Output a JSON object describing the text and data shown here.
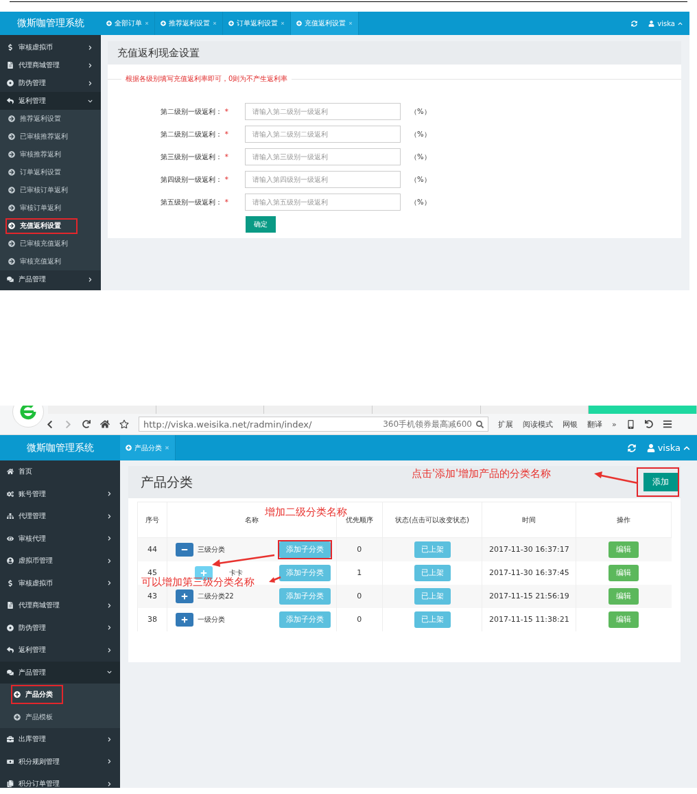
{
  "recharge_screen": {
    "app_title": "微斯咖管理系统",
    "user": "viska",
    "tabs": [
      {
        "label": "全部订单",
        "selected": false
      },
      {
        "label": "推荐返利设置",
        "selected": false
      },
      {
        "label": "订单返利设置",
        "selected": false
      },
      {
        "label": "充值返利设置",
        "selected": true
      }
    ],
    "sidebar": [
      {
        "label": "审核虚拟币",
        "expanded": false
      },
      {
        "label": "代理商城管理",
        "expanded": false
      },
      {
        "label": "防伪管理",
        "expanded": false
      },
      {
        "label": "返利管理",
        "expanded": true,
        "children": [
          {
            "label": "推荐返利设置",
            "selected": false,
            "annotated": false
          },
          {
            "label": "已审核推荐返利",
            "selected": false,
            "annotated": false
          },
          {
            "label": "审核推荐返利",
            "selected": false,
            "annotated": false
          },
          {
            "label": "订单返利设置",
            "selected": false,
            "annotated": false
          },
          {
            "label": "已审核订单返利",
            "selected": false,
            "annotated": false
          },
          {
            "label": "审核订单返利",
            "selected": false,
            "annotated": false
          },
          {
            "label": "充值返利设置",
            "selected": true,
            "annotated": true
          },
          {
            "label": "已审核充值返利",
            "selected": false,
            "annotated": false
          },
          {
            "label": "审核充值返利",
            "selected": false,
            "annotated": false
          }
        ]
      },
      {
        "label": "产品管理",
        "expanded": false
      }
    ],
    "page_title": "充值返利现金设置",
    "notice": "根据各级别填写充值返利率即可，0则为不产生返利率",
    "fields": [
      {
        "label": "第二级别一级返利：",
        "required": "*",
        "placeholder": "请输入第二级别一级返利",
        "unit": "（%）"
      },
      {
        "label": "第二级别二级返利：",
        "required": "*",
        "placeholder": "请输入第二级别二级返利",
        "unit": "（%）"
      },
      {
        "label": "第三级别一级返利：",
        "required": "*",
        "placeholder": "请输入第三级别一级返利",
        "unit": "（%）"
      },
      {
        "label": "第四级别一级返利：",
        "required": "*",
        "placeholder": "请输入第四级别一级返利",
        "unit": "（%）"
      },
      {
        "label": "第五级别一级返利：",
        "required": "*",
        "placeholder": "请输入第五级别一级返利",
        "unit": "（%）"
      }
    ],
    "submit": "确定"
  },
  "product_screen": {
    "browser": {
      "tabs": [
        {
          "selected": false
        },
        {
          "selected": false
        },
        {
          "selected": false
        },
        {
          "selected": false
        },
        {
          "selected": false
        },
        {
          "selected": true
        }
      ],
      "url": "http://viska.weisika.net/radmin/index/",
      "search": "360手机领券最高减600",
      "toolbar_items": [
        "扩展",
        "阅读模式",
        "网银",
        "翻译",
        "»"
      ]
    },
    "app_title": "微斯咖管理系统",
    "tabs": [
      {
        "label": "产品分类",
        "selected": true
      }
    ],
    "user": "viska",
    "sidebar": [
      {
        "label": "首页",
        "has_arrow": false
      },
      {
        "label": "账号管理",
        "has_arrow": true,
        "expanded": false
      },
      {
        "label": "代理管理",
        "has_arrow": true,
        "expanded": false
      },
      {
        "label": "审核代理",
        "has_arrow": true,
        "expanded": false
      },
      {
        "label": "虚拟币管理",
        "has_arrow": true,
        "expanded": false
      },
      {
        "label": "审核虚拟币",
        "has_arrow": true,
        "expanded": false
      },
      {
        "label": "代理商城管理",
        "has_arrow": true,
        "expanded": false
      },
      {
        "label": "防伪管理",
        "has_arrow": true,
        "expanded": false
      },
      {
        "label": "返利管理",
        "has_arrow": true,
        "expanded": false
      },
      {
        "label": "产品管理",
        "has_arrow": true,
        "expanded": true,
        "children": [
          {
            "label": "产品分类",
            "selected": true,
            "annotated": true
          },
          {
            "label": "产品模板",
            "selected": false,
            "annotated": false
          }
        ]
      },
      {
        "label": "出库管理",
        "has_arrow": true,
        "expanded": false
      },
      {
        "label": "积分规则管理",
        "has_arrow": true,
        "expanded": false
      },
      {
        "label": "积分订单管理",
        "has_arrow": true,
        "expanded": false
      }
    ],
    "page_title": "产品分类",
    "add_button": {
      "label": "添加",
      "annotated": true
    },
    "table": {
      "columns": [
        "序号",
        "名称",
        "优先顺序",
        "状态(点击可以改变状态)",
        "时间",
        "操作"
      ],
      "rows": [
        {
          "id": "44",
          "name": "三级分类",
          "expanded": true,
          "add_child": {
            "label": "添加子分类",
            "annotated": true
          },
          "priority": "0",
          "status": "已上架",
          "time": "2017-11-30 16:37:17",
          "action": "编辑",
          "children": [
            {
              "id": "45",
              "name": "卡卡",
              "expanded": false,
              "add_child": {
                "label": "添加子分类",
                "annotated": false
              },
              "priority": "1",
              "status": "已上架",
              "time": "2017-11-30 16:37:45",
              "action": "编辑"
            }
          ]
        },
        {
          "id": "43",
          "name": "二级分类22",
          "expanded": false,
          "add_child": {
            "label": "添加子分类",
            "annotated": false
          },
          "priority": "0",
          "status": "已上架",
          "time": "2017-11-15 21:56:19",
          "action": "编辑"
        },
        {
          "id": "38",
          "name": "一级分类",
          "expanded": false,
          "add_child": {
            "label": "添加子分类",
            "annotated": false
          },
          "priority": "0",
          "status": "已上架",
          "time": "2017-11-15 11:38:21",
          "action": "编辑"
        }
      ]
    },
    "annotations": [
      {
        "text": "点击'添加'增加产品的分类名称"
      },
      {
        "text": "增加二级分类名称"
      },
      {
        "text": "可以增加第三级分类名称"
      }
    ]
  }
}
